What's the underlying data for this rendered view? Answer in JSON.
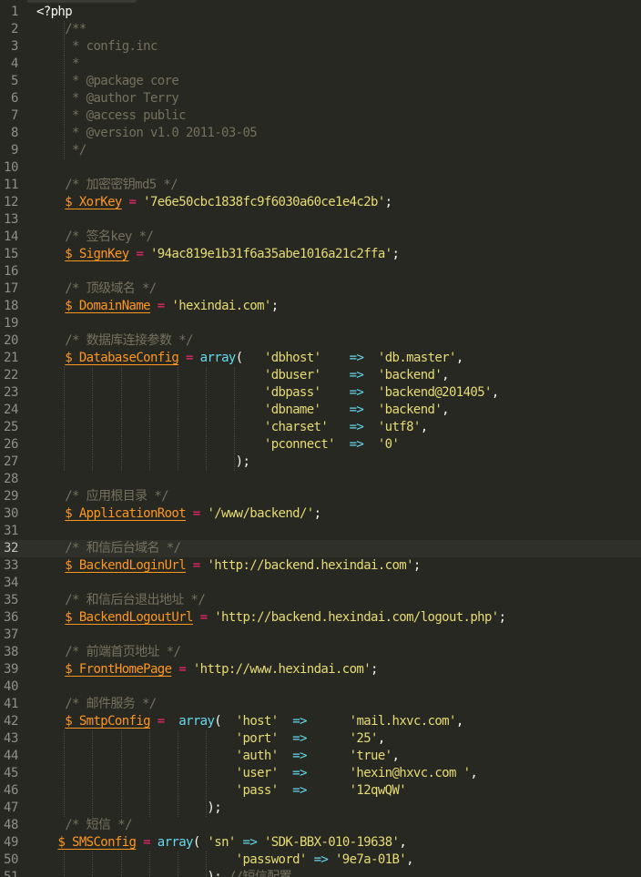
{
  "editor": {
    "theme": "monokai",
    "colors": {
      "background": "#272822",
      "line_numbers": "#8f908a",
      "plain": "#f8f8f2",
      "comment": "#75715e",
      "variable": "#fd971f",
      "string": "#e6db74",
      "keyword": "#66d9ef",
      "operator": "#f92672"
    },
    "current_line": 32,
    "lines": [
      {
        "n": "1",
        "tokens": [
          {
            "t": "<?php",
            "c": "plain"
          }
        ]
      },
      {
        "n": "2",
        "tokens": [
          {
            "t": "    /**",
            "c": "comment"
          }
        ]
      },
      {
        "n": "3",
        "tokens": [
          {
            "t": "     * config.inc",
            "c": "comment"
          }
        ]
      },
      {
        "n": "4",
        "tokens": [
          {
            "t": "     *",
            "c": "comment"
          }
        ]
      },
      {
        "n": "5",
        "tokens": [
          {
            "t": "     * @package core",
            "c": "comment"
          }
        ]
      },
      {
        "n": "6",
        "tokens": [
          {
            "t": "     * @author Terry",
            "c": "comment"
          }
        ]
      },
      {
        "n": "7",
        "tokens": [
          {
            "t": "     * @access public",
            "c": "comment"
          }
        ]
      },
      {
        "n": "8",
        "tokens": [
          {
            "t": "     * @version v1.0 2011-03-05",
            "c": "comment"
          }
        ]
      },
      {
        "n": "9",
        "tokens": [
          {
            "t": "     */",
            "c": "comment"
          }
        ]
      },
      {
        "n": "10",
        "tokens": []
      },
      {
        "n": "11",
        "tokens": [
          {
            "t": "    /* 加密密钥md5 */",
            "c": "comment"
          }
        ]
      },
      {
        "n": "12",
        "tokens": [
          {
            "t": "    ",
            "c": "plain"
          },
          {
            "t": "$_XorKey",
            "c": "var"
          },
          {
            "t": " = ",
            "c": "op"
          },
          {
            "t": "'7e6e50cbc1838fc9f6030a60ce1e4c2b'",
            "c": "str"
          },
          {
            "t": ";",
            "c": "plain"
          }
        ]
      },
      {
        "n": "13",
        "tokens": []
      },
      {
        "n": "14",
        "tokens": [
          {
            "t": "    /* 签名key */",
            "c": "comment"
          }
        ]
      },
      {
        "n": "15",
        "tokens": [
          {
            "t": "    ",
            "c": "plain"
          },
          {
            "t": "$_SignKey",
            "c": "var"
          },
          {
            "t": " = ",
            "c": "op"
          },
          {
            "t": "'94ac819e1b31f6a35abe1016a21c2ffa'",
            "c": "str"
          },
          {
            "t": ";",
            "c": "plain"
          }
        ]
      },
      {
        "n": "16",
        "tokens": []
      },
      {
        "n": "17",
        "tokens": [
          {
            "t": "    /* 顶级域名 */",
            "c": "comment"
          }
        ]
      },
      {
        "n": "18",
        "tokens": [
          {
            "t": "    ",
            "c": "plain"
          },
          {
            "t": "$_DomainName",
            "c": "var"
          },
          {
            "t": " = ",
            "c": "op"
          },
          {
            "t": "'hexindai.com'",
            "c": "str"
          },
          {
            "t": ";",
            "c": "plain"
          }
        ]
      },
      {
        "n": "19",
        "tokens": []
      },
      {
        "n": "20",
        "tokens": [
          {
            "t": "    /* 数据库连接参数 */",
            "c": "comment"
          }
        ]
      },
      {
        "n": "21",
        "tokens": [
          {
            "t": "    ",
            "c": "plain"
          },
          {
            "t": "$_DatabaseConfig",
            "c": "var"
          },
          {
            "t": " = ",
            "c": "op"
          },
          {
            "t": "array",
            "c": "kw"
          },
          {
            "t": "(   ",
            "c": "plain"
          },
          {
            "t": "'dbhost'",
            "c": "str"
          },
          {
            "t": "    ",
            "c": "plain"
          },
          {
            "t": "=>",
            "c": "arrow"
          },
          {
            "t": "  ",
            "c": "plain"
          },
          {
            "t": "'db.master'",
            "c": "str"
          },
          {
            "t": ",",
            "c": "plain"
          }
        ]
      },
      {
        "n": "22",
        "tokens": [
          {
            "t": "                                ",
            "c": "plain"
          },
          {
            "t": "'dbuser'",
            "c": "str"
          },
          {
            "t": "    ",
            "c": "plain"
          },
          {
            "t": "=>",
            "c": "arrow"
          },
          {
            "t": "  ",
            "c": "plain"
          },
          {
            "t": "'backend'",
            "c": "str"
          },
          {
            "t": ",",
            "c": "plain"
          }
        ]
      },
      {
        "n": "23",
        "tokens": [
          {
            "t": "                                ",
            "c": "plain"
          },
          {
            "t": "'dbpass'",
            "c": "str"
          },
          {
            "t": "    ",
            "c": "plain"
          },
          {
            "t": "=>",
            "c": "arrow"
          },
          {
            "t": "  ",
            "c": "plain"
          },
          {
            "t": "'backend@201405'",
            "c": "str"
          },
          {
            "t": ",",
            "c": "plain"
          }
        ]
      },
      {
        "n": "24",
        "tokens": [
          {
            "t": "                                ",
            "c": "plain"
          },
          {
            "t": "'dbname'",
            "c": "str"
          },
          {
            "t": "    ",
            "c": "plain"
          },
          {
            "t": "=>",
            "c": "arrow"
          },
          {
            "t": "  ",
            "c": "plain"
          },
          {
            "t": "'backend'",
            "c": "str"
          },
          {
            "t": ",",
            "c": "plain"
          }
        ]
      },
      {
        "n": "25",
        "tokens": [
          {
            "t": "                                ",
            "c": "plain"
          },
          {
            "t": "'charset'",
            "c": "str"
          },
          {
            "t": "   ",
            "c": "plain"
          },
          {
            "t": "=>",
            "c": "arrow"
          },
          {
            "t": "  ",
            "c": "plain"
          },
          {
            "t": "'utf8'",
            "c": "str"
          },
          {
            "t": ",",
            "c": "plain"
          }
        ]
      },
      {
        "n": "26",
        "tokens": [
          {
            "t": "                                ",
            "c": "plain"
          },
          {
            "t": "'pconnect'",
            "c": "str"
          },
          {
            "t": "  ",
            "c": "plain"
          },
          {
            "t": "=>",
            "c": "arrow"
          },
          {
            "t": "  ",
            "c": "plain"
          },
          {
            "t": "'0'",
            "c": "str"
          }
        ]
      },
      {
        "n": "27",
        "tokens": [
          {
            "t": "                            );",
            "c": "plain"
          }
        ]
      },
      {
        "n": "28",
        "tokens": []
      },
      {
        "n": "29",
        "tokens": [
          {
            "t": "    /* 应用根目录 */",
            "c": "comment"
          }
        ]
      },
      {
        "n": "30",
        "tokens": [
          {
            "t": "    ",
            "c": "plain"
          },
          {
            "t": "$_ApplicationRoot",
            "c": "var"
          },
          {
            "t": " = ",
            "c": "op"
          },
          {
            "t": "'/www/backend/'",
            "c": "str"
          },
          {
            "t": ";",
            "c": "plain"
          }
        ]
      },
      {
        "n": "31",
        "tokens": []
      },
      {
        "n": "32",
        "tokens": [
          {
            "t": "    /* 和信后台域名 */",
            "c": "comment"
          }
        ]
      },
      {
        "n": "33",
        "tokens": [
          {
            "t": "    ",
            "c": "plain"
          },
          {
            "t": "$_BackendLoginUrl",
            "c": "var"
          },
          {
            "t": " = ",
            "c": "op"
          },
          {
            "t": "'http://backend.hexindai.com'",
            "c": "str"
          },
          {
            "t": ";",
            "c": "plain"
          }
        ]
      },
      {
        "n": "34",
        "tokens": []
      },
      {
        "n": "35",
        "tokens": [
          {
            "t": "    /* 和信后台退出地址 */",
            "c": "comment"
          }
        ]
      },
      {
        "n": "36",
        "tokens": [
          {
            "t": "    ",
            "c": "plain"
          },
          {
            "t": "$_BackendLogoutUrl",
            "c": "var"
          },
          {
            "t": " = ",
            "c": "op"
          },
          {
            "t": "'http://backend.hexindai.com/logout.php'",
            "c": "str"
          },
          {
            "t": ";",
            "c": "plain"
          }
        ]
      },
      {
        "n": "37",
        "tokens": []
      },
      {
        "n": "38",
        "tokens": [
          {
            "t": "    /* 前端首页地址 */",
            "c": "comment"
          }
        ]
      },
      {
        "n": "39",
        "tokens": [
          {
            "t": "    ",
            "c": "plain"
          },
          {
            "t": "$_FrontHomePage",
            "c": "var"
          },
          {
            "t": " = ",
            "c": "op"
          },
          {
            "t": "'http://www.hexindai.com'",
            "c": "str"
          },
          {
            "t": ";",
            "c": "plain"
          }
        ]
      },
      {
        "n": "40",
        "tokens": []
      },
      {
        "n": "41",
        "tokens": [
          {
            "t": "    /* 邮件服务 */",
            "c": "comment"
          }
        ]
      },
      {
        "n": "42",
        "tokens": [
          {
            "t": "    ",
            "c": "plain"
          },
          {
            "t": "$_SmtpConfig",
            "c": "var"
          },
          {
            "t": " =  ",
            "c": "op"
          },
          {
            "t": "array",
            "c": "kw"
          },
          {
            "t": "(  ",
            "c": "plain"
          },
          {
            "t": "'host'",
            "c": "str"
          },
          {
            "t": "  ",
            "c": "plain"
          },
          {
            "t": "=>",
            "c": "arrow"
          },
          {
            "t": "      ",
            "c": "plain"
          },
          {
            "t": "'mail.hxvc.com'",
            "c": "str"
          },
          {
            "t": ",",
            "c": "plain"
          }
        ]
      },
      {
        "n": "43",
        "tokens": [
          {
            "t": "                            ",
            "c": "plain"
          },
          {
            "t": "'port'",
            "c": "str"
          },
          {
            "t": "  ",
            "c": "plain"
          },
          {
            "t": "=>",
            "c": "arrow"
          },
          {
            "t": "      ",
            "c": "plain"
          },
          {
            "t": "'25'",
            "c": "str"
          },
          {
            "t": ",",
            "c": "plain"
          }
        ]
      },
      {
        "n": "44",
        "tokens": [
          {
            "t": "                            ",
            "c": "plain"
          },
          {
            "t": "'auth'",
            "c": "str"
          },
          {
            "t": "  ",
            "c": "plain"
          },
          {
            "t": "=>",
            "c": "arrow"
          },
          {
            "t": "      ",
            "c": "plain"
          },
          {
            "t": "'true'",
            "c": "str"
          },
          {
            "t": ",",
            "c": "plain"
          }
        ]
      },
      {
        "n": "45",
        "tokens": [
          {
            "t": "                            ",
            "c": "plain"
          },
          {
            "t": "'user'",
            "c": "str"
          },
          {
            "t": "  ",
            "c": "plain"
          },
          {
            "t": "=>",
            "c": "arrow"
          },
          {
            "t": "      ",
            "c": "plain"
          },
          {
            "t": "'hexin@hxvc.com '",
            "c": "str"
          },
          {
            "t": ",",
            "c": "plain"
          }
        ]
      },
      {
        "n": "46",
        "tokens": [
          {
            "t": "                            ",
            "c": "plain"
          },
          {
            "t": "'pass'",
            "c": "str"
          },
          {
            "t": "  ",
            "c": "plain"
          },
          {
            "t": "=>",
            "c": "arrow"
          },
          {
            "t": "      ",
            "c": "plain"
          },
          {
            "t": "'12qwQW'",
            "c": "str"
          }
        ]
      },
      {
        "n": "47",
        "tokens": [
          {
            "t": "                        );",
            "c": "plain"
          }
        ]
      },
      {
        "n": "48",
        "tokens": [
          {
            "t": "    /* 短信 */",
            "c": "comment"
          }
        ]
      },
      {
        "n": "49",
        "tokens": [
          {
            "t": "   ",
            "c": "plain"
          },
          {
            "t": "$_SMSConfig",
            "c": "var"
          },
          {
            "t": " = ",
            "c": "op"
          },
          {
            "t": "array",
            "c": "kw"
          },
          {
            "t": "( ",
            "c": "plain"
          },
          {
            "t": "'sn'",
            "c": "str"
          },
          {
            "t": " ",
            "c": "plain"
          },
          {
            "t": "=>",
            "c": "arrow"
          },
          {
            "t": " ",
            "c": "plain"
          },
          {
            "t": "'SDK-BBX-010-19638'",
            "c": "str"
          },
          {
            "t": ",",
            "c": "plain"
          }
        ]
      },
      {
        "n": "50",
        "tokens": [
          {
            "t": "                            ",
            "c": "plain"
          },
          {
            "t": "'password'",
            "c": "str"
          },
          {
            "t": " ",
            "c": "plain"
          },
          {
            "t": "=>",
            "c": "arrow"
          },
          {
            "t": " ",
            "c": "plain"
          },
          {
            "t": "'9e7a-01B'",
            "c": "str"
          },
          {
            "t": ",",
            "c": "plain"
          }
        ]
      },
      {
        "n": "51",
        "tokens": [
          {
            "t": "                        ); ",
            "c": "plain"
          },
          {
            "t": "//短信配置",
            "c": "comment"
          }
        ]
      }
    ]
  }
}
